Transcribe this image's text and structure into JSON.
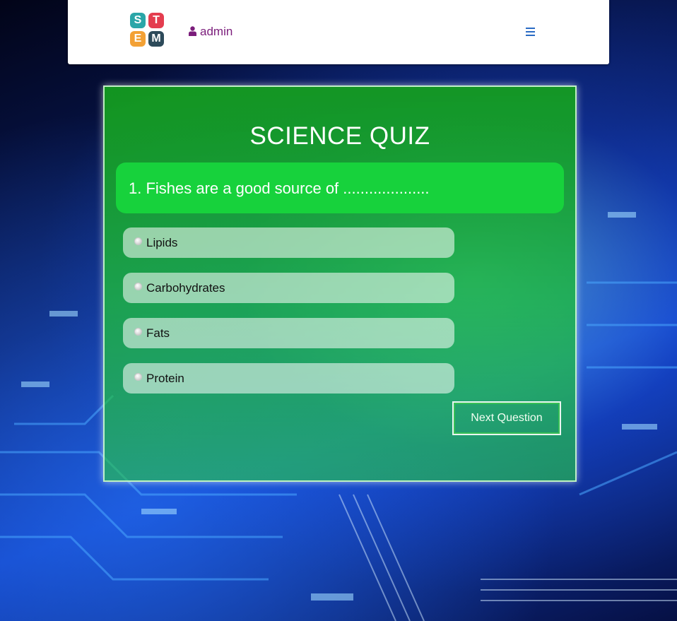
{
  "colors": {
    "card_green": "#17a826",
    "question_green": "#17d23c",
    "user_purple": "#7b1d7b",
    "menu_blue": "#2a6bc4"
  },
  "header": {
    "logo": [
      {
        "letter": "S",
        "color": "#2ba6a8"
      },
      {
        "letter": "T",
        "color": "#e43d4f"
      },
      {
        "letter": "E",
        "color": "#f3a135"
      },
      {
        "letter": "M",
        "color": "#2d4a5a"
      }
    ],
    "user_icon": "user-icon",
    "username": "admin",
    "menu_icon": "hamburger-menu-icon"
  },
  "quiz": {
    "title": "SCIENCE QUIZ",
    "question": "1. Fishes are a good source of ....................",
    "options": [
      "Lipids",
      "Carbohydrates",
      "Fats",
      "Protein"
    ],
    "next_label": "Next Question"
  }
}
